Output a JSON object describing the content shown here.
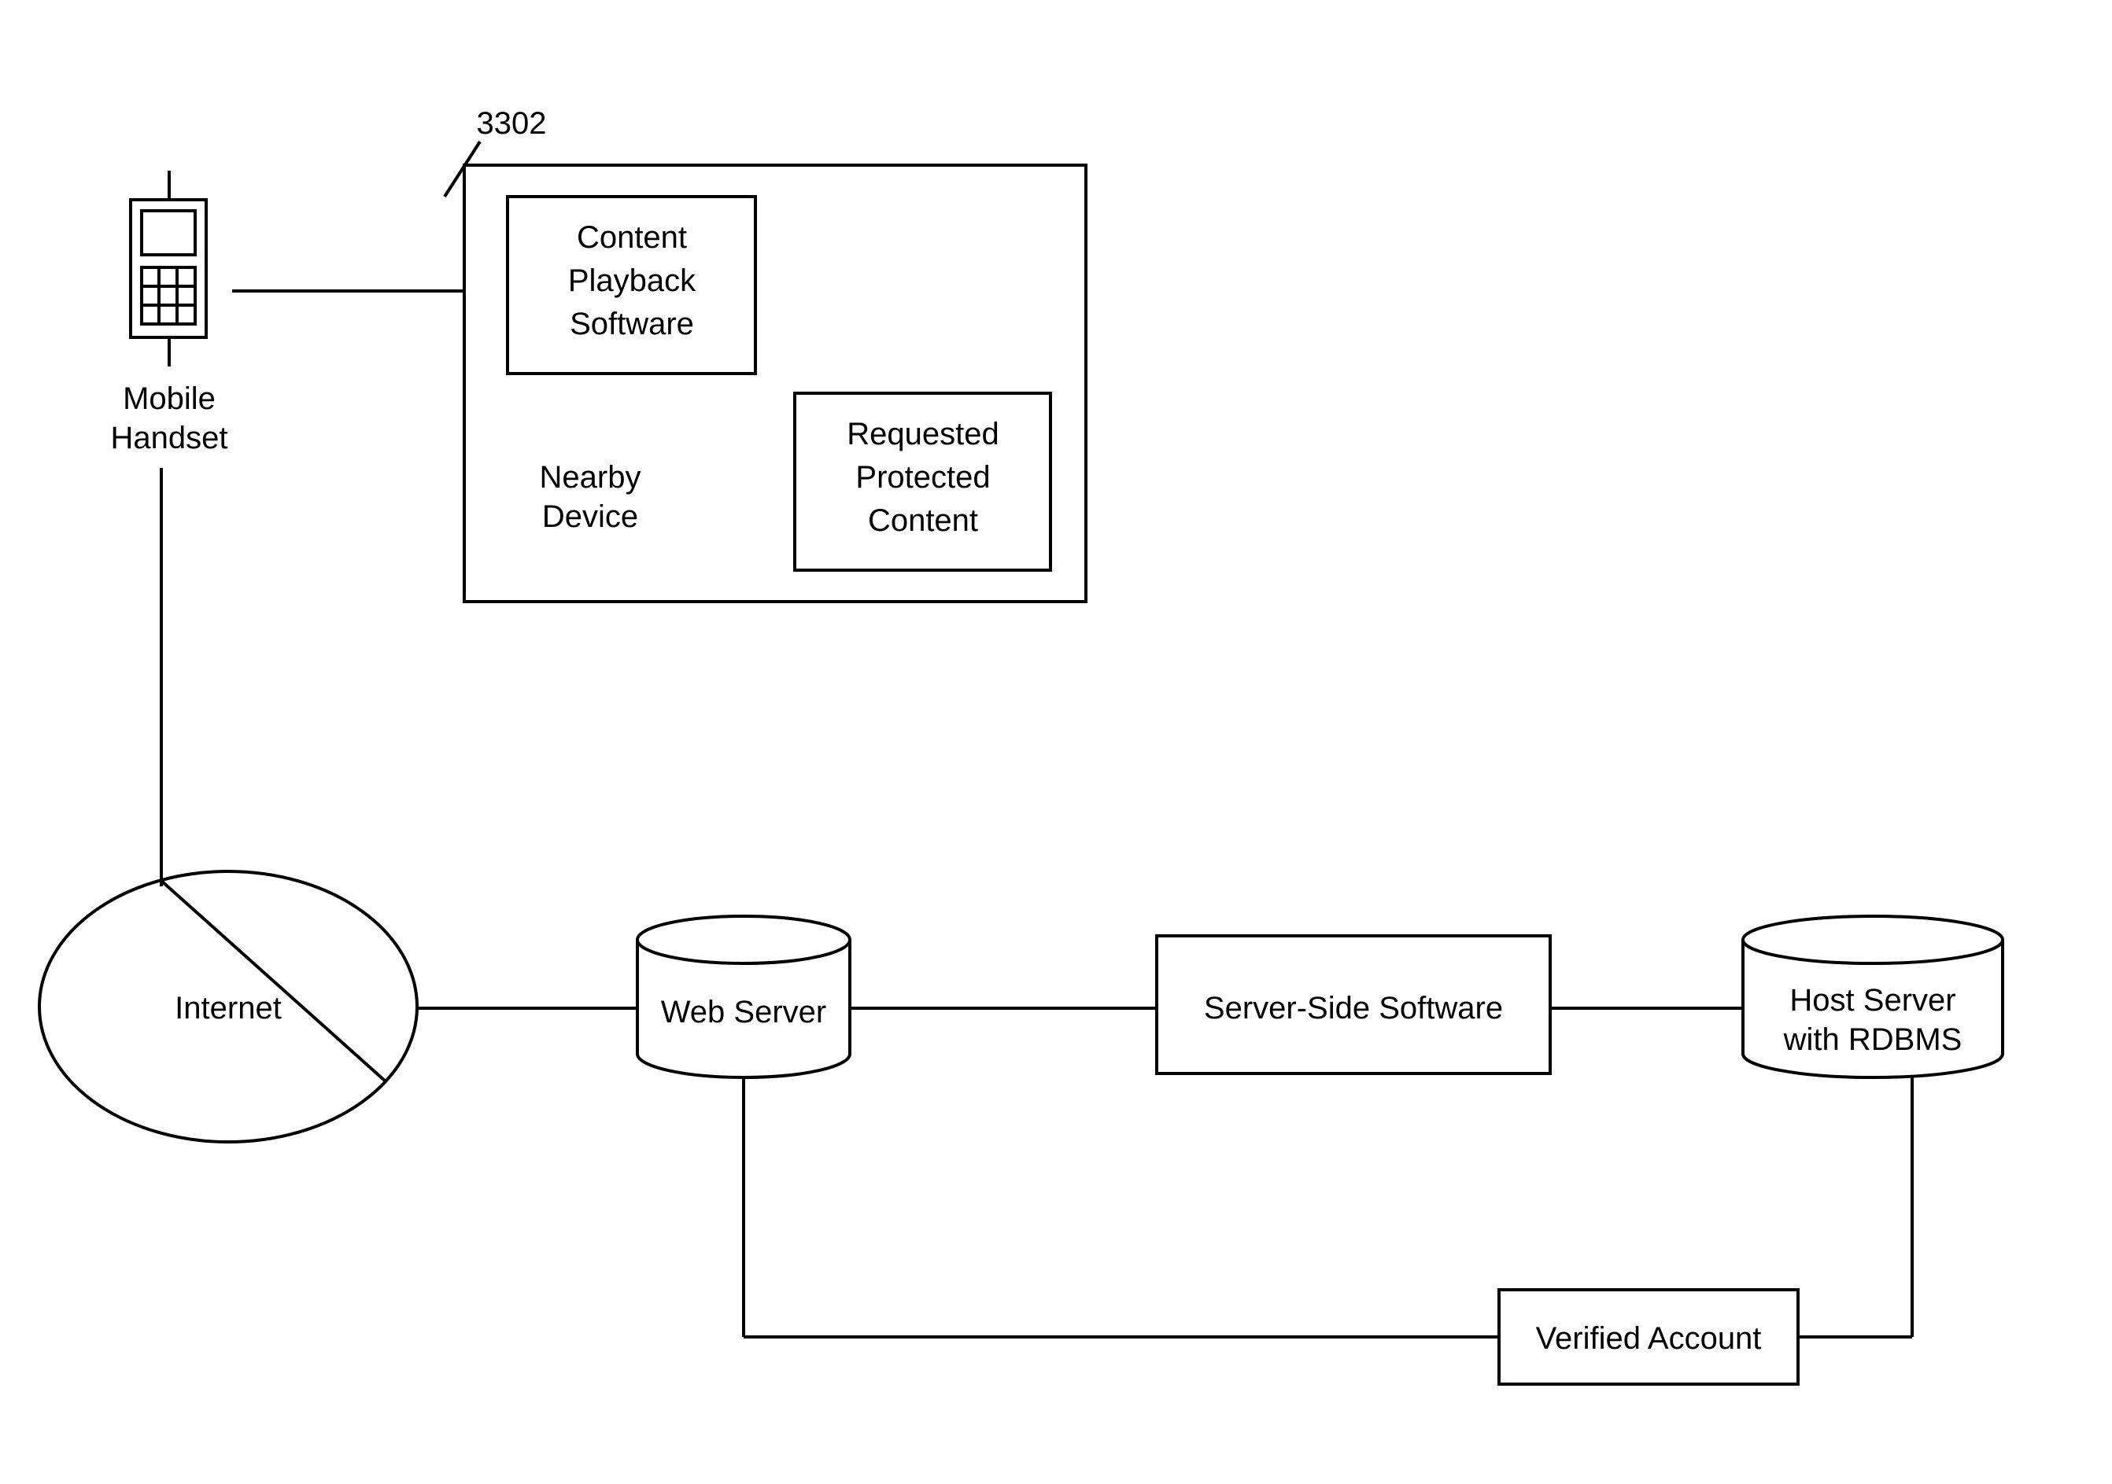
{
  "referenceNumber": "3302",
  "mobileHandset": {
    "label1": "Mobile",
    "label2": "Handset"
  },
  "nearbyDevice": {
    "label1": "Nearby",
    "label2": "Device",
    "contentPlayback": {
      "line1": "Content",
      "line2": "Playback",
      "line3": "Software"
    },
    "requestedContent": {
      "line1": "Requested",
      "line2": "Protected",
      "line3": "Content"
    }
  },
  "internet": {
    "label": "Internet"
  },
  "webServer": {
    "label": "Web Server"
  },
  "serverSideSoftware": {
    "label": "Server-Side Software"
  },
  "hostServer": {
    "label1": "Host Server",
    "label2": "with RDBMS"
  },
  "verifiedAccount": {
    "label": "Verified Account"
  }
}
